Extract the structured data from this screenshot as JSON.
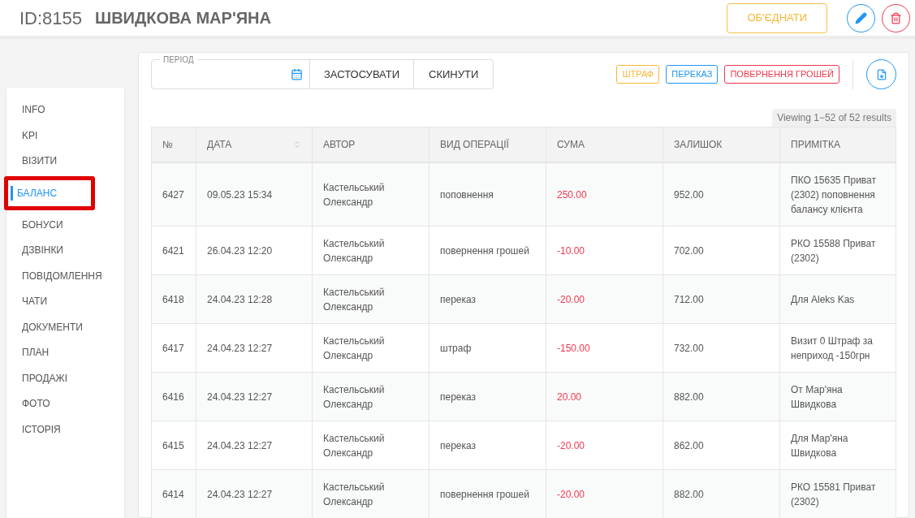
{
  "header": {
    "id": "ID:8155",
    "name": "ШВИДКОВА МАР'ЯНА",
    "merge_button": "ОБ'ЄДНАТИ"
  },
  "sidebar": {
    "items": [
      {
        "label": "INFO",
        "selected": false,
        "highlighted": false
      },
      {
        "label": "KPI",
        "selected": false,
        "highlighted": false
      },
      {
        "label": "ВІЗИТИ",
        "selected": false,
        "highlighted": false
      },
      {
        "label": "БАЛАНС",
        "selected": true,
        "highlighted": true
      },
      {
        "label": "БОНУСИ",
        "selected": false,
        "highlighted": false
      },
      {
        "label": "ДЗВІНКИ",
        "selected": false,
        "highlighted": false
      },
      {
        "label": "ПОВІДОМЛЕННЯ",
        "selected": false,
        "highlighted": false
      },
      {
        "label": "ЧАТИ",
        "selected": false,
        "highlighted": false
      },
      {
        "label": "ДОКУМЕНТИ",
        "selected": false,
        "highlighted": false
      },
      {
        "label": "ПЛАН",
        "selected": false,
        "highlighted": false
      },
      {
        "label": "ПРОДАЖІ",
        "selected": false,
        "highlighted": false
      },
      {
        "label": "ФОТО",
        "selected": false,
        "highlighted": false
      },
      {
        "label": "ІСТОРІЯ",
        "selected": false,
        "highlighted": false
      }
    ]
  },
  "filter": {
    "period_label": "ПЕРІОД",
    "apply_button": "ЗАСТОСУВАТИ",
    "reset_button": "СКИНУТИ"
  },
  "legend": [
    {
      "label": "ШТРАФ",
      "color": "#f7b733"
    },
    {
      "label": "ПЕРЕКАЗ",
      "color": "#2196f3"
    },
    {
      "label": "ПОВЕРНЕННЯ ГРОШЕЙ",
      "color": "#f0394f"
    }
  ],
  "summary": "Viewing 1−52 of 52 results",
  "table": {
    "columns": [
      "№",
      "ДАТА",
      "АВТОР",
      "ВИД ОПЕРАЦІЇ",
      "СУМА",
      "ЗАЛИШОК",
      "ПРИМІТКА"
    ],
    "rows": [
      [
        "6427",
        "09.05.23 15:34",
        "Кастельський Олександр",
        "поповнення",
        "250.00",
        "952.00",
        "ПКО 15635 Приват (2302) поповнення балансу клієнта"
      ],
      [
        "6421",
        "26.04.23 12:20",
        "Кастельський Олександр",
        "повернення грошей",
        "-10.00",
        "702.00",
        "РКО 15588 Приват (2302)"
      ],
      [
        "6418",
        "24.04.23 12:28",
        "Кастельський Олександр",
        "переказ",
        "-20.00",
        "712.00",
        "Для Aleks Kas"
      ],
      [
        "6417",
        "24.04.23 12:27",
        "Кастельський Олександр",
        "штраф",
        "-150.00",
        "732.00",
        "Визит 0 Штраф за неприход -150грн"
      ],
      [
        "6416",
        "24.04.23 12:27",
        "Кастельський Олександр",
        "переказ",
        "20.00",
        "882.00",
        "От Мар'яна Швидкова"
      ],
      [
        "6415",
        "24.04.23 12:27",
        "Кастельський Олександр",
        "переказ",
        "-20.00",
        "862.00",
        "Для Мар'яна Швидкова"
      ],
      [
        "6414",
        "24.04.23 12:27",
        "Кастельський Олександр",
        "повернення грошей",
        "-20.00",
        "882.00",
        "РКО 15581 Приват (2302)"
      ]
    ]
  }
}
